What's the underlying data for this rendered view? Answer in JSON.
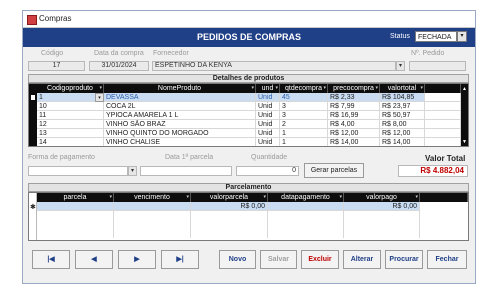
{
  "window": {
    "title": "Compras"
  },
  "header": {
    "title": "PEDIDOS DE COMPRAS",
    "status_label": "Status",
    "status_value": "FECHADA"
  },
  "form": {
    "codigo_label": "Código",
    "codigo": "17",
    "data_label": "Data da compra",
    "data": "31/01/2024",
    "fornecedor_label": "Fornecedor",
    "fornecedor": "ESPETINHO DA KENYA",
    "pedido_label": "Nº. Pedido",
    "pedido": ""
  },
  "produtos": {
    "section_title": "Detalhes de produtos",
    "columns": [
      "Codigoproduto",
      "NomeProduto",
      "und",
      "qtdecompra",
      "precocompra",
      "valortotal"
    ],
    "rows": [
      {
        "codigo": "1",
        "nome": "DEVASSA",
        "und": "Unid",
        "qtd": "45",
        "preco": "R$ 2,33",
        "total": "R$ 104,85"
      },
      {
        "codigo": "10",
        "nome": "COCA 2L",
        "und": "Unid",
        "qtd": "3",
        "preco": "R$ 7,99",
        "total": "R$ 23,97"
      },
      {
        "codigo": "11",
        "nome": "YPIOCA AMARELA 1 L",
        "und": "Unid",
        "qtd": "3",
        "preco": "R$ 16,99",
        "total": "R$ 50,97"
      },
      {
        "codigo": "12",
        "nome": "VINHO SÃO BRAZ",
        "und": "Unid",
        "qtd": "2",
        "preco": "R$ 4,00",
        "total": "R$ 8,00"
      },
      {
        "codigo": "13",
        "nome": "VINHO QUINTO DO MORGADO",
        "und": "Unid",
        "qtd": "1",
        "preco": "R$ 12,00",
        "total": "R$ 12,00"
      },
      {
        "codigo": "14",
        "nome": "VINHO CHALISE",
        "und": "Unid",
        "qtd": "1",
        "preco": "R$ 14,00",
        "total": "R$ 14,00"
      }
    ]
  },
  "pagamento": {
    "forma_label": "Forma de pagamento",
    "forma": "",
    "data_parcela_label": "Data 1ª parcela",
    "data_parcela": "",
    "quantidade_label": "Quantidade",
    "quantidade": "0",
    "gerar_label": "Gerar parcelas",
    "valor_total_label": "Valor Total",
    "valor_total": "R$ 4.882,04"
  },
  "parcelas": {
    "section_title": "Parcelamento",
    "columns": [
      "parcela",
      "vencimento",
      "valorparcela",
      "datapagamento",
      "valorpago"
    ],
    "new_row": {
      "valorparcela": "R$ 0,00",
      "valorpago": "R$ 0,00"
    }
  },
  "nav": {
    "first": "|◀",
    "prev": "◀",
    "next": "▶",
    "last": "▶|"
  },
  "actions": {
    "novo": "Novo",
    "salvar": "Salvar",
    "excluir": "Excluir",
    "alterar": "Alterar",
    "procurar": "Procurar",
    "fechar": "Fechar"
  },
  "colors": {
    "header": "#1f3f87",
    "valor_total": "#c00000",
    "excluir": "#c00000",
    "disabled": "#a0a0a0"
  }
}
